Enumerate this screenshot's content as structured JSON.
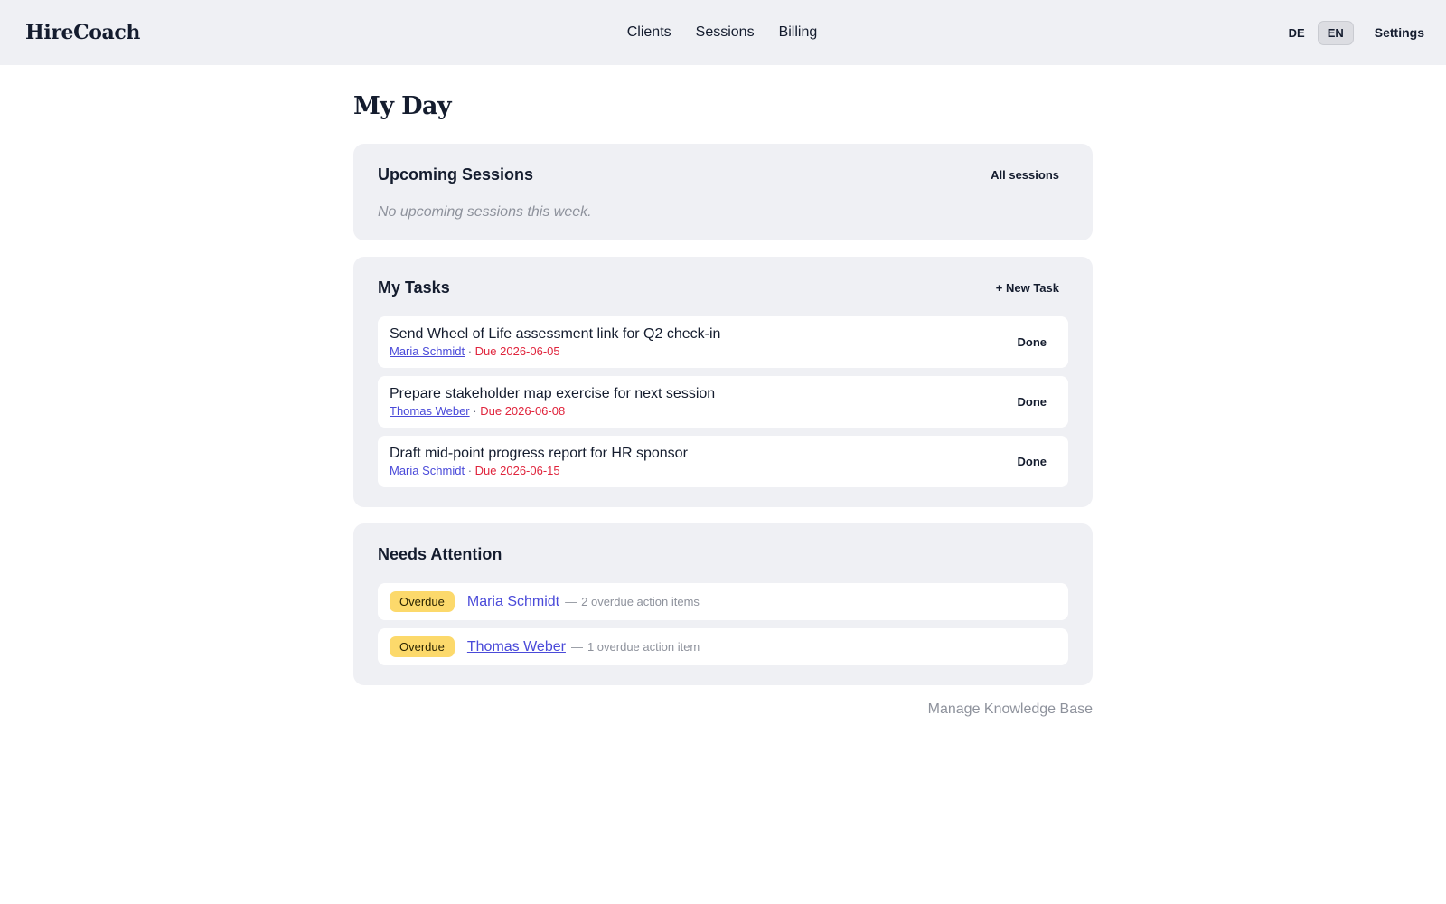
{
  "header": {
    "brand": "HireCoach",
    "nav": [
      "Clients",
      "Sessions",
      "Billing"
    ],
    "lang_de": "DE",
    "lang_en": "EN",
    "settings": "Settings"
  },
  "page": {
    "title": "My Day"
  },
  "sessions": {
    "title": "Upcoming Sessions",
    "action": "All sessions",
    "empty": "No upcoming sessions this week."
  },
  "tasks": {
    "title": "My Tasks",
    "action": "+ New Task",
    "done_label": "Done",
    "separator": "·",
    "items": [
      {
        "title": "Send Wheel of Life assessment link for Q2 check-in",
        "client": "Maria Schmidt",
        "due": "Due 2026-06-05"
      },
      {
        "title": "Prepare stakeholder map exercise for next session",
        "client": "Thomas Weber",
        "due": "Due 2026-06-08"
      },
      {
        "title": "Draft mid-point progress report for HR sponsor",
        "client": "Maria Schmidt",
        "due": "Due 2026-06-15"
      }
    ]
  },
  "attention": {
    "title": "Needs Attention",
    "separator": "—",
    "items": [
      {
        "badge": "Overdue",
        "client": "Maria Schmidt",
        "note": "2 overdue action items"
      },
      {
        "badge": "Overdue",
        "client": "Thomas Weber",
        "note": "1 overdue action item"
      }
    ]
  },
  "footer": {
    "link": "Manage Knowledge Base"
  },
  "colors": {
    "accent_link": "#4a4ad9",
    "due_red": "#e0243c",
    "badge_yellow": "#fcd96b",
    "card_bg": "#eff0f4"
  }
}
